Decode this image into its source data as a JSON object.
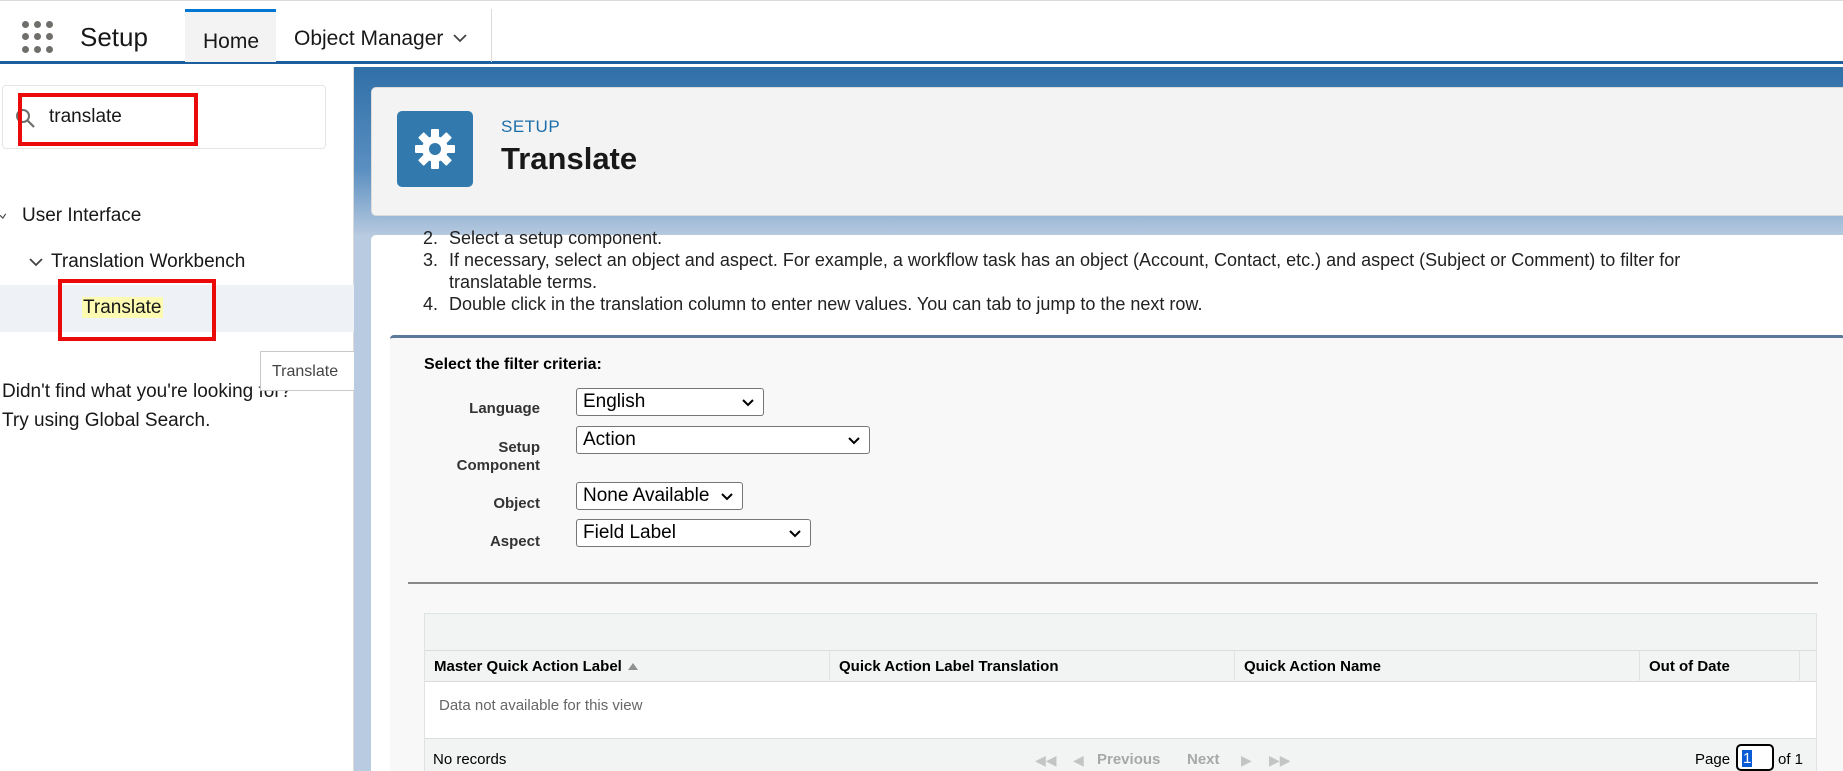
{
  "nav": {
    "app_name": "Setup",
    "tabs": [
      {
        "label": "Home",
        "active": true
      },
      {
        "label": "Object Manager",
        "has_dropdown": true
      }
    ]
  },
  "sidebar": {
    "search_value": "translate",
    "tree": {
      "root": "User Interface",
      "child": "Translation Workbench",
      "leaf": "Translate"
    },
    "tooltip": "Translate",
    "nofind_line1": "Didn't find what you're looking for?",
    "nofind_line2": "Try using Global Search."
  },
  "header": {
    "eyebrow": "SETUP",
    "title": "Translate",
    "icon": "gear-icon"
  },
  "instructions": {
    "step2": "Select a setup component.",
    "step3_line1": "If necessary, select an object and aspect. For example, a workflow task has an object (Account, Contact, etc.) and aspect (Subject or Comment) to filter for",
    "step3_line2": "translatable terms.",
    "step4": "Double click in the translation column to enter new values. You can tab to jump to the next row."
  },
  "filter": {
    "title": "Select the filter criteria:",
    "language_label": "Language",
    "language_value": "English",
    "component_label_1": "Setup",
    "component_label_2": "Component",
    "component_value": "Action",
    "object_label": "Object",
    "object_value": "None Available",
    "aspect_label": "Aspect",
    "aspect_value": "Field Label"
  },
  "table": {
    "columns": [
      "Master Quick Action Label",
      "Quick Action Label Translation",
      "Quick Action Name",
      "Out of Date"
    ],
    "empty_message": "Data not available for this view",
    "footer": {
      "records": "No records",
      "previous": "Previous",
      "next": "Next",
      "page_label": "Page",
      "page_value": "1",
      "of_label": "of 1"
    }
  },
  "colors": {
    "brand_blue": "#0176d3",
    "highlight_red": "#ea0a0a",
    "gear_tile": "#327aad"
  }
}
